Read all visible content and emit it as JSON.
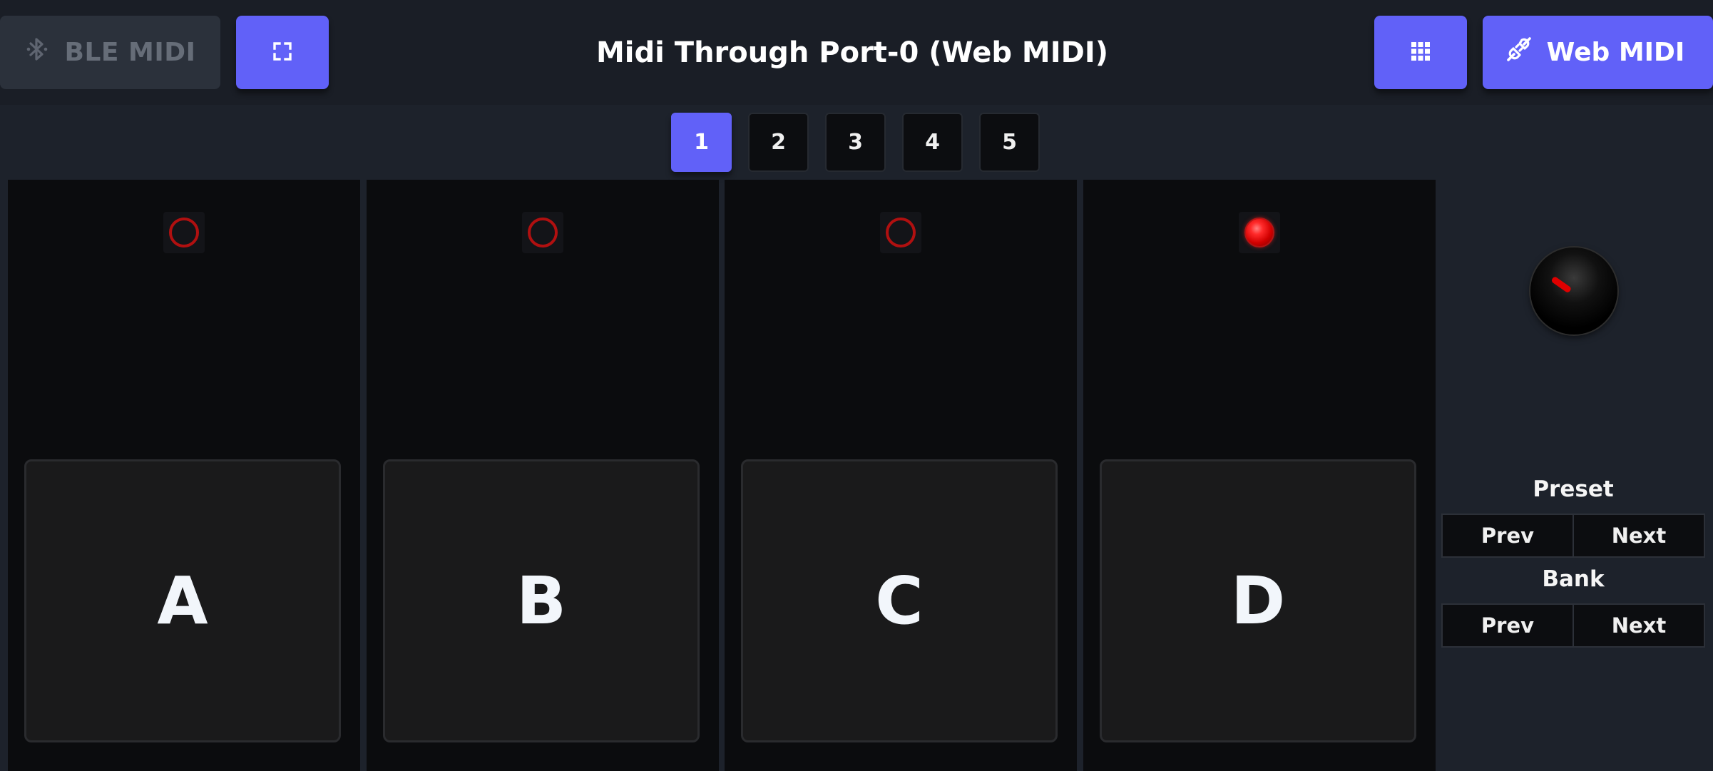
{
  "header": {
    "ble_button": {
      "label": "BLE MIDI",
      "icon": "bluetooth-icon"
    },
    "fullscreen_button": {
      "icon": "fullscreen-icon"
    },
    "port_title": "Midi Through Port-0 (Web MIDI)",
    "grid_button": {
      "icon": "grid-icon"
    },
    "webmidi_button": {
      "label": "Web MIDI",
      "icon": "plug-icon"
    }
  },
  "bank_tabs": {
    "items": [
      "1",
      "2",
      "3",
      "4",
      "5"
    ],
    "active": "1"
  },
  "channels": [
    {
      "label": "A",
      "led_on": false
    },
    {
      "label": "B",
      "led_on": false
    },
    {
      "label": "C",
      "led_on": false
    },
    {
      "label": "D",
      "led_on": true
    }
  ],
  "controls": {
    "knob": {
      "icon": "knob-icon"
    },
    "preset": {
      "label": "Preset",
      "prev_label": "Prev",
      "next_label": "Next"
    },
    "bank": {
      "label": "Bank",
      "prev_label": "Prev",
      "next_label": "Next"
    }
  },
  "colors": {
    "accent": "#6161f8",
    "led_red": "#ff2a2a",
    "background": "#1d222b",
    "channel_bg": "#0b0c0e"
  }
}
